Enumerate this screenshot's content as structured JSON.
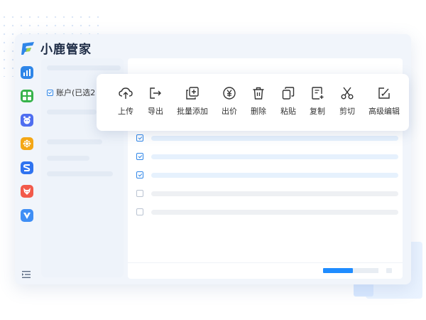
{
  "app": {
    "title": "小鹿管家",
    "logo_icon": "deer-logo-icon",
    "brand_color": "#2f86e8"
  },
  "sidebar": {
    "icons": [
      {
        "name": "chart-icon",
        "color": "#2f86e8"
      },
      {
        "name": "grid-icon",
        "color": "#36b34a"
      },
      {
        "name": "mascot-icon",
        "color": "#4f6ef0"
      },
      {
        "name": "flower-icon",
        "color": "#f4a716"
      },
      {
        "name": "s-logo-icon",
        "color": "#2f73f0"
      },
      {
        "name": "fox-icon",
        "color": "#f25a4a"
      },
      {
        "name": "v-logo-icon",
        "color": "#3f8ef5"
      }
    ],
    "collapse_icon": "collapse-menu-icon"
  },
  "account_panel": {
    "checkbox_label": "账户(已选2",
    "checked": true
  },
  "toolbar": {
    "items": [
      {
        "label": "上传",
        "icon": "upload-icon"
      },
      {
        "label": "导出",
        "icon": "export-icon"
      },
      {
        "label": "批量添加",
        "icon": "batch-add-icon"
      },
      {
        "label": "出价",
        "icon": "yuan-icon"
      },
      {
        "label": "删除",
        "icon": "trash-icon"
      },
      {
        "label": "粘贴",
        "icon": "paste-icon"
      },
      {
        "label": "复制",
        "icon": "copy-icon"
      },
      {
        "label": "剪切",
        "icon": "scissors-icon"
      },
      {
        "label": "高级编辑",
        "icon": "advanced-edit-icon"
      }
    ]
  },
  "table": {
    "rows": [
      {
        "checked": true
      },
      {
        "checked": true
      },
      {
        "checked": true
      },
      {
        "checked": false
      },
      {
        "checked": false
      }
    ]
  },
  "pagination": {
    "progress": 0.5
  }
}
